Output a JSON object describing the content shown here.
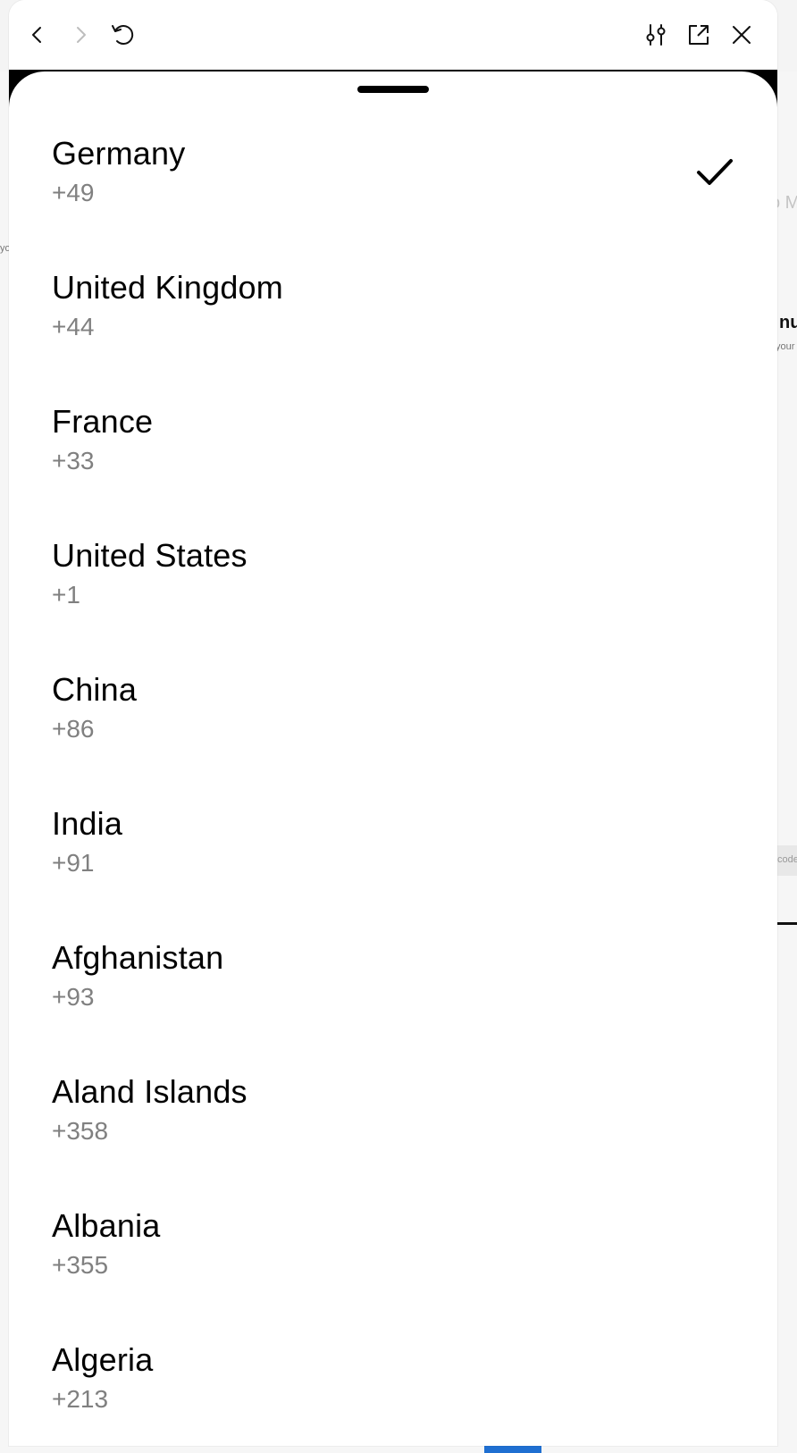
{
  "toolbar": {
    "icons": [
      "back-icon",
      "forward-icon",
      "reload-icon",
      "settings-sliders-icon",
      "open-external-icon",
      "close-icon"
    ],
    "forward_disabled": true
  },
  "background": {
    "snippets": [
      "o M",
      "nu",
      "your",
      "yo",
      "code"
    ]
  },
  "country_picker": {
    "selected_index": 0,
    "countries": [
      {
        "name": "Germany",
        "code": "+49"
      },
      {
        "name": "United Kingdom",
        "code": "+44"
      },
      {
        "name": "France",
        "code": "+33"
      },
      {
        "name": "United States",
        "code": "+1"
      },
      {
        "name": "China",
        "code": "+86"
      },
      {
        "name": "India",
        "code": "+91"
      },
      {
        "name": "Afghanistan",
        "code": "+93"
      },
      {
        "name": "Aland Islands",
        "code": "+358"
      },
      {
        "name": "Albania",
        "code": "+355"
      },
      {
        "name": "Algeria",
        "code": "+213"
      }
    ]
  },
  "colors": {
    "text_primary": "#000000",
    "text_secondary": "#808080",
    "accent_check": "#000000"
  }
}
